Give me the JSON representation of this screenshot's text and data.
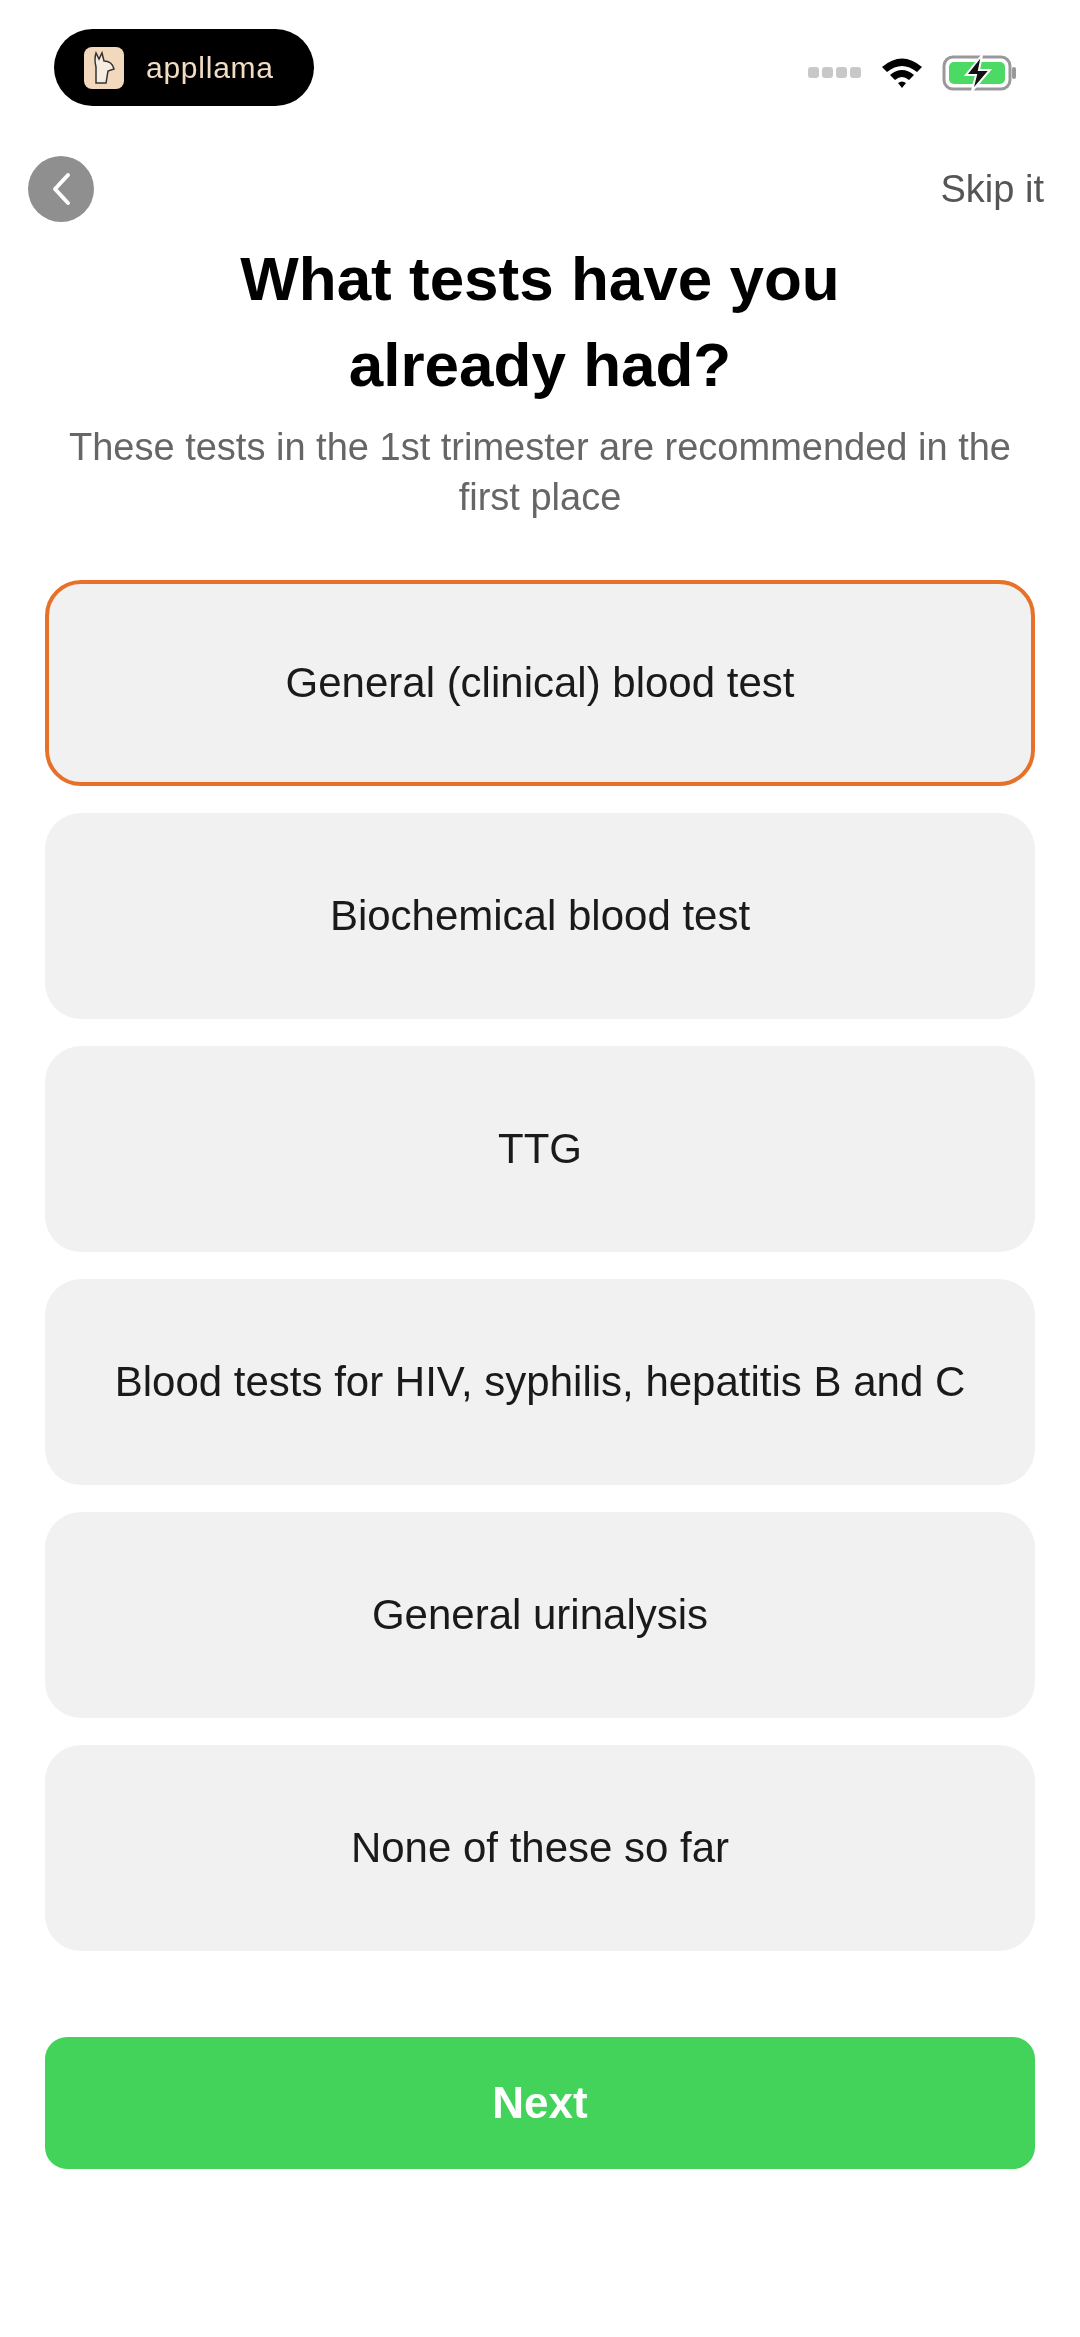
{
  "status_bar": {
    "app_badge": "appllama"
  },
  "header": {
    "skip": "Skip it"
  },
  "title": "What tests have you already had?",
  "subtitle": "These tests in the 1st trimester are recommended in the first place",
  "options": [
    {
      "label": "General (clinical) blood test",
      "selected": true
    },
    {
      "label": "Biochemical blood test",
      "selected": false
    },
    {
      "label": "TTG",
      "selected": false
    },
    {
      "label": "Blood tests for HIV, syphilis, hepatitis B and C",
      "selected": false
    },
    {
      "label": "General urinalysis",
      "selected": false
    },
    {
      "label": "None of these so far",
      "selected": false
    }
  ],
  "next_button": "Next"
}
